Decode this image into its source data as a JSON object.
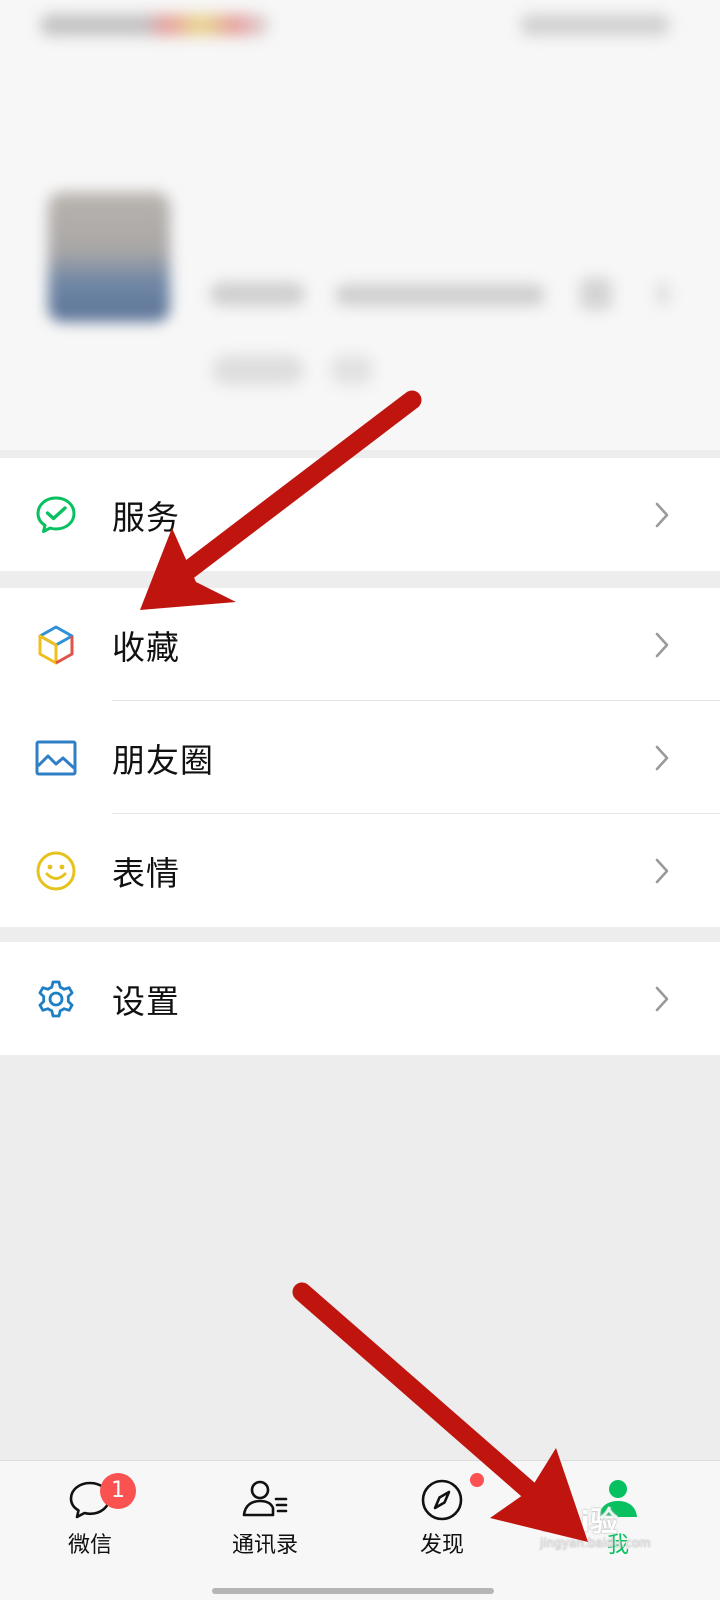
{
  "menu": {
    "services": {
      "label": "服务"
    },
    "favorites": {
      "label": "收藏"
    },
    "moments": {
      "label": "朋友圈"
    },
    "stickers": {
      "label": "表情"
    },
    "settings": {
      "label": "设置"
    }
  },
  "tabbar": {
    "chats": {
      "label": "微信",
      "badge": "1"
    },
    "contacts": {
      "label": "通讯录"
    },
    "discover": {
      "label": "发现"
    },
    "me": {
      "label": "我"
    }
  },
  "watermark": {
    "text": "Bai验",
    "sub": "jingyan.baidu.com"
  },
  "colors": {
    "accent_green": "#07c160",
    "badge_red": "#fa5151",
    "arrow_red": "#c0160f",
    "settings_blue": "#1f7fc4",
    "sticker_yellow": "#e6c21d"
  },
  "icons": {
    "services": "wechat-pay-icon",
    "favorites": "cube-icon",
    "moments": "picture-icon",
    "stickers": "smiley-icon",
    "settings": "gear-icon"
  }
}
